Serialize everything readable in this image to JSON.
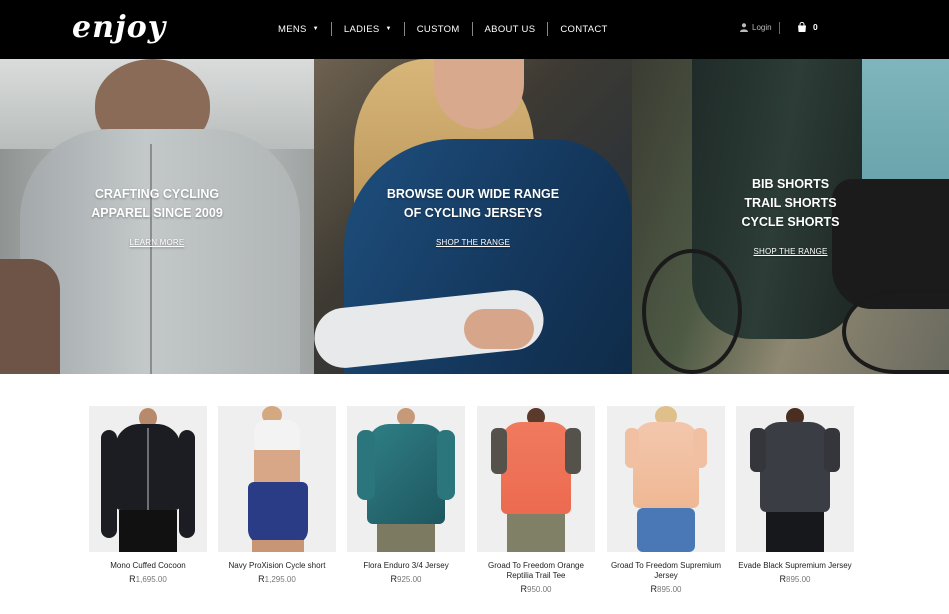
{
  "header": {
    "logo_text": "enjoy",
    "nav": [
      {
        "label": "MENS",
        "dropdown": true
      },
      {
        "label": "LADIES",
        "dropdown": true
      },
      {
        "label": "CUSTOM",
        "dropdown": false
      },
      {
        "label": "ABOUT US",
        "dropdown": false
      },
      {
        "label": "CONTACT",
        "dropdown": false
      }
    ],
    "login_label": "Login",
    "cart_count": "0",
    "icons": {
      "login": "user-icon",
      "cart": "shopping-bag-icon",
      "dropdown": "caret-down-icon"
    }
  },
  "hero": [
    {
      "lines": [
        "CRAFTING CYCLING",
        "APPAREL SINCE 2009"
      ],
      "link": "LEARN MORE"
    },
    {
      "lines": [
        "BROWSE OUR WIDE RANGE",
        "OF CYCLING JERSEYS"
      ],
      "link": "SHOP THE RANGE"
    },
    {
      "lines": [
        "BIB SHORTS",
        "TRAIL SHORTS",
        "CYCLE SHORTS"
      ],
      "link": "SHOP THE RANGE"
    }
  ],
  "products": [
    {
      "name": "Mono Cuffed Cocoon",
      "currency": "R",
      "price": "1,695.00"
    },
    {
      "name": "Navy ProXision Cycle short",
      "currency": "R",
      "price": "1,295.00"
    },
    {
      "name": "Flora Enduro 3/4 Jersey",
      "currency": "R",
      "price": "925.00"
    },
    {
      "name": "Groad To Freedom Orange Reptilia Trail Tee",
      "currency": "R",
      "price": "950.00"
    },
    {
      "name": "Groad To Freedom Supremium Jersey",
      "currency": "R",
      "price": "895.00"
    },
    {
      "name": "Evade Black Supremium Jersey",
      "currency": "R",
      "price": "895.00"
    }
  ],
  "colors": {
    "header_bg": "#000000",
    "text": "#222222",
    "price": "#777777",
    "card_bg": "#efefef"
  }
}
